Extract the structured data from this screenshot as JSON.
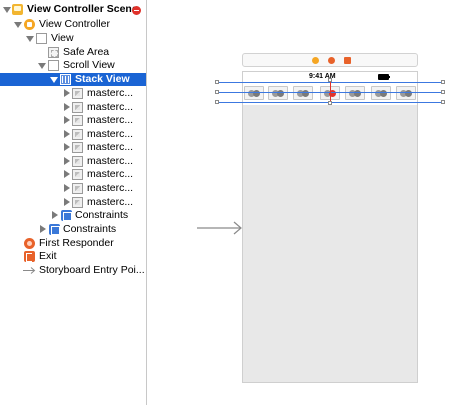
{
  "outline": {
    "scene_label": "View Controller Scene",
    "items": [
      {
        "label": "View Controller"
      },
      {
        "label": "View"
      },
      {
        "label": "Safe Area"
      },
      {
        "label": "Scroll View"
      },
      {
        "label": "Stack View"
      },
      {
        "label": "masterc..."
      },
      {
        "label": "masterc..."
      },
      {
        "label": "masterc..."
      },
      {
        "label": "masterc..."
      },
      {
        "label": "masterc..."
      },
      {
        "label": "masterc..."
      },
      {
        "label": "masterc..."
      },
      {
        "label": "masterc..."
      },
      {
        "label": "masterc..."
      },
      {
        "label": "Constraints"
      },
      {
        "label": "Constraints"
      },
      {
        "label": "First Responder"
      },
      {
        "label": "Exit"
      },
      {
        "label": "Storyboard Entry Poi..."
      }
    ]
  },
  "canvas": {
    "status_time": "9:41 AM"
  },
  "colors": {
    "selection": "#1a64d4",
    "stack_guide": "#3c78e0",
    "badge_red": "#e0322b",
    "device_bg": "#e8e8e8"
  },
  "icons": {
    "scene": "storyboard-scene-icon",
    "view_controller": "view-controller-icon",
    "view": "view-icon",
    "safe_area": "safe-area-icon",
    "stack_view": "stack-view-icon",
    "image": "image-view-icon",
    "constraints": "constraints-icon",
    "first_responder": "first-responder-icon",
    "exit": "exit-icon",
    "entry": "entry-arrow-icon"
  }
}
